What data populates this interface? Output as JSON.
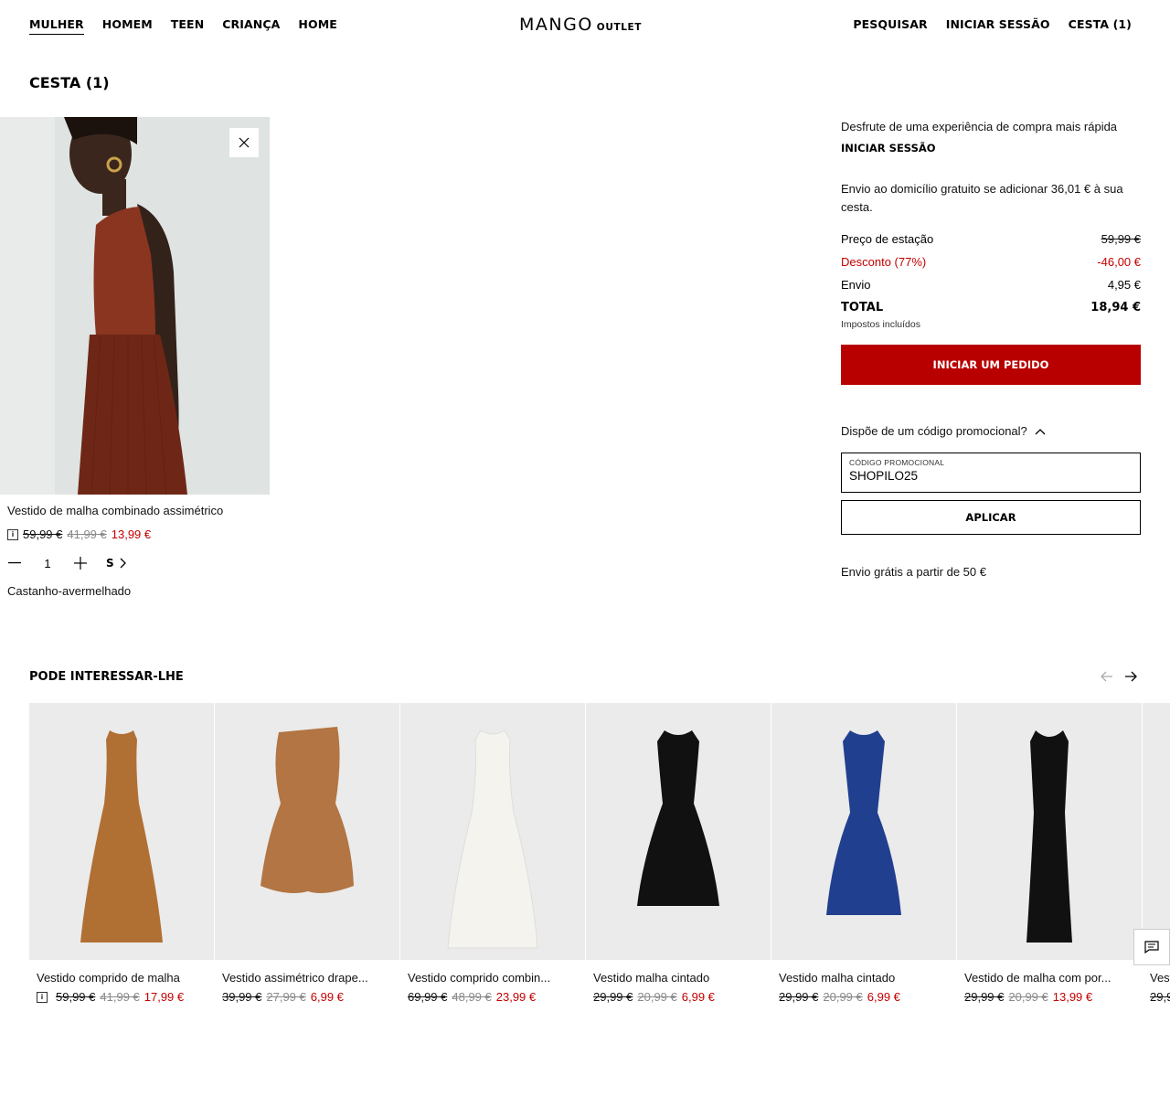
{
  "header": {
    "nav_left": [
      "MULHER",
      "HOMEM",
      "TEEN",
      "CRIANÇA",
      "HOME"
    ],
    "logo_brand": "MANGO",
    "logo_sub": "OUTLET",
    "nav_right": [
      "PESQUISAR",
      "INICIAR SESSÃO",
      "CESTA (1)"
    ]
  },
  "page_title": "CESTA (1)",
  "cart_item": {
    "name": "Vestido de malha combinado assimétrico",
    "info_icon": "i",
    "price_original": "59,99 €",
    "price_previous": "41,99 €",
    "price_sale": "13,99 €",
    "quantity": "1",
    "size": "S",
    "color": "Castanho-avermelhado",
    "image_colors": {
      "background": "#dfe3e2",
      "dress": "#7b2e1b",
      "skin": "#3a261c"
    }
  },
  "summary": {
    "faster_text": "Desfrute de uma experiência de compra mais rápida",
    "login_label": "INICIAR SESSÃO",
    "shipping_note": "Envio ao domicílio gratuito se adicionar 36,01 € à sua cesta.",
    "season_price_label": "Preço de estação",
    "season_price_value": "59,99 €",
    "discount_label": "Desconto (77%)",
    "discount_value": "-46,00 €",
    "shipping_label": "Envio",
    "shipping_value": "4,95 €",
    "total_label": "TOTAL",
    "total_value": "18,94 €",
    "taxes_label": "Impostos incluídos",
    "order_button": "INICIAR UM PEDIDO",
    "promo_toggle": "Dispõe de um código promocional?",
    "promo_field_label": "CÓDIGO PROMOCIONAL",
    "promo_value": "SHOPILO25",
    "apply_button": "APLICAR",
    "free_shipping": "Envio grátis a partir de 50 €"
  },
  "recommendations": {
    "title": "PODE INTERESSAR-LHE",
    "items": [
      {
        "name": "Vestido comprido de malha",
        "info": "i",
        "p1": "59,99 €",
        "p2": "41,99 €",
        "p3": "17,99 €",
        "color": "#b07034"
      },
      {
        "name": "Vestido assimétrico drape...",
        "info": "",
        "p1": "39,99 €",
        "p2": "27,99 €",
        "p3": "6,99 €",
        "color": "#b27543"
      },
      {
        "name": "Vestido comprido combin...",
        "info": "",
        "p1": "69,99 €",
        "p2": "48,99 €",
        "p3": "23,99 €",
        "color": "#f5f3ee"
      },
      {
        "name": "Vestido malha cintado",
        "info": "",
        "p1": "29,99 €",
        "p2": "20,99 €",
        "p3": "6,99 €",
        "color": "#111111"
      },
      {
        "name": "Vestido malha cintado",
        "info": "",
        "p1": "29,99 €",
        "p2": "20,99 €",
        "p3": "6,99 €",
        "color": "#213f8f"
      },
      {
        "name": "Vestido de malha com por...",
        "info": "",
        "p1": "29,99 €",
        "p2": "20,99 €",
        "p3": "13,99 €",
        "color": "#111111"
      },
      {
        "name": "Vest",
        "info": "",
        "p1": "29,9",
        "p2": "",
        "p3": "",
        "color": "#ebebeb"
      }
    ]
  }
}
